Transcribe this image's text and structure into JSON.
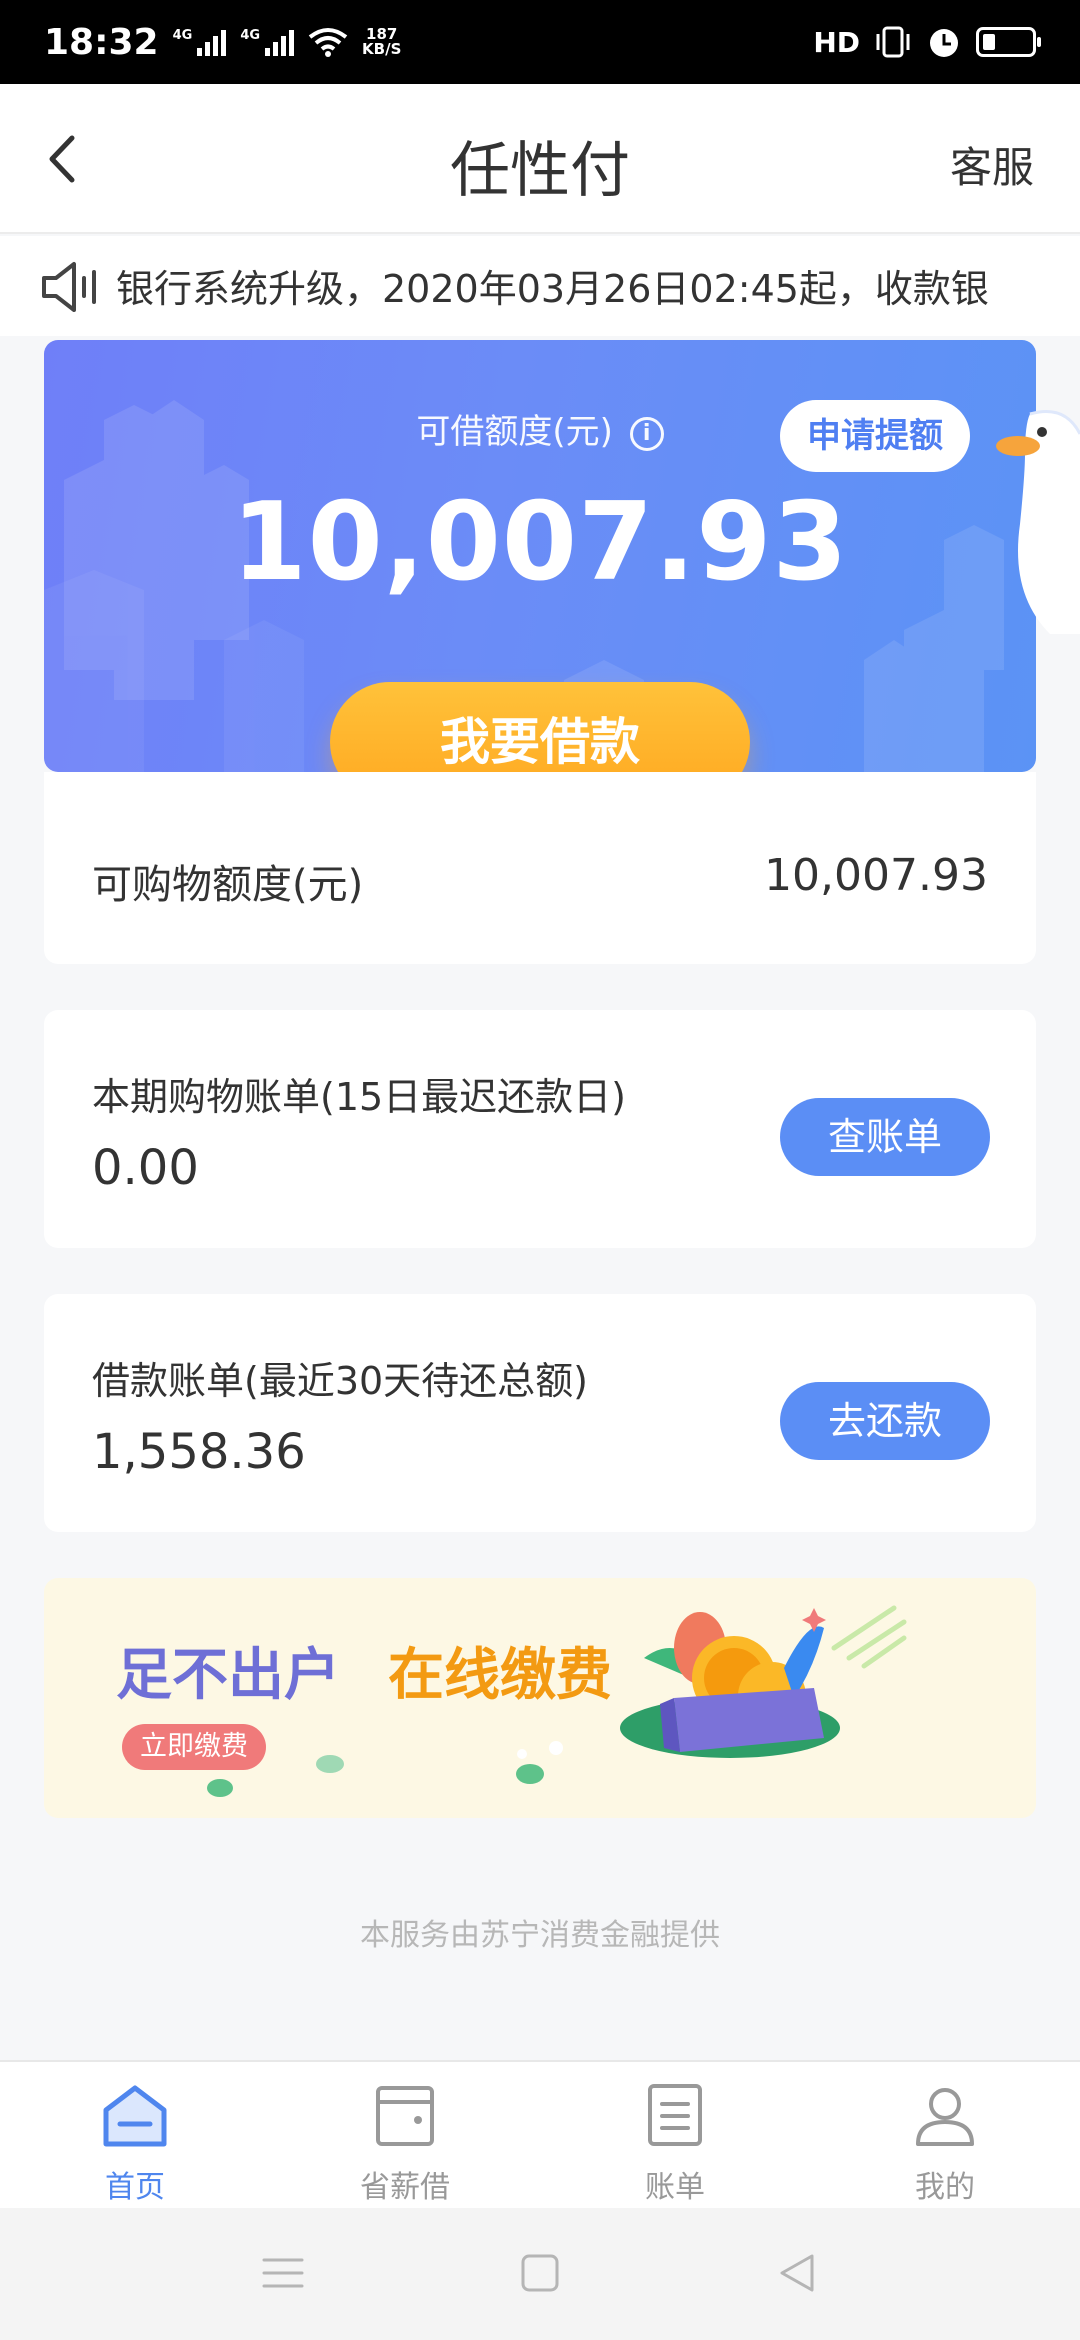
{
  "status_bar": {
    "time": "18:32",
    "network_1": "4G",
    "network_2": "4G",
    "speed_value": "187",
    "speed_unit": "KB/S",
    "hd": "HD"
  },
  "nav": {
    "title": "任性付",
    "customer_service": "客服"
  },
  "notice": {
    "text": "银行系统升级，2020年03月26日02:45起，收款银"
  },
  "hero": {
    "available_label": "可借额度(元)",
    "info_glyph": "i",
    "available_amount": "10,007.93",
    "raise_limit_label": "申请提额",
    "borrow_button": "我要借款"
  },
  "shopping_limit": {
    "label": "可购物额度(元)",
    "value": "10,007.93"
  },
  "shopping_bill": {
    "title": "本期购物账单(15日最迟还款日)",
    "amount": "0.00",
    "button": "查账单"
  },
  "loan_bill": {
    "title": "借款账单(最近30天待还总额)",
    "amount": "1,558.36",
    "button": "去还款"
  },
  "banner": {
    "title_part1": "足不出户",
    "title_part2": "在线缴费",
    "tag": "立即缴费"
  },
  "footer": {
    "provider": "本服务由苏宁消费金融提供"
  },
  "tabs": [
    {
      "label": "首页",
      "icon": "home-icon",
      "active": true
    },
    {
      "label": "省薪借",
      "icon": "wallet-icon",
      "active": false
    },
    {
      "label": "账单",
      "icon": "bill-icon",
      "active": false
    },
    {
      "label": "我的",
      "icon": "profile-icon",
      "active": false
    }
  ],
  "colors": {
    "primary": "#5b8ef5",
    "borrow_button": "#ffb02b",
    "banner_purple": "#6e6fd6",
    "banner_orange": "#f39a12"
  }
}
